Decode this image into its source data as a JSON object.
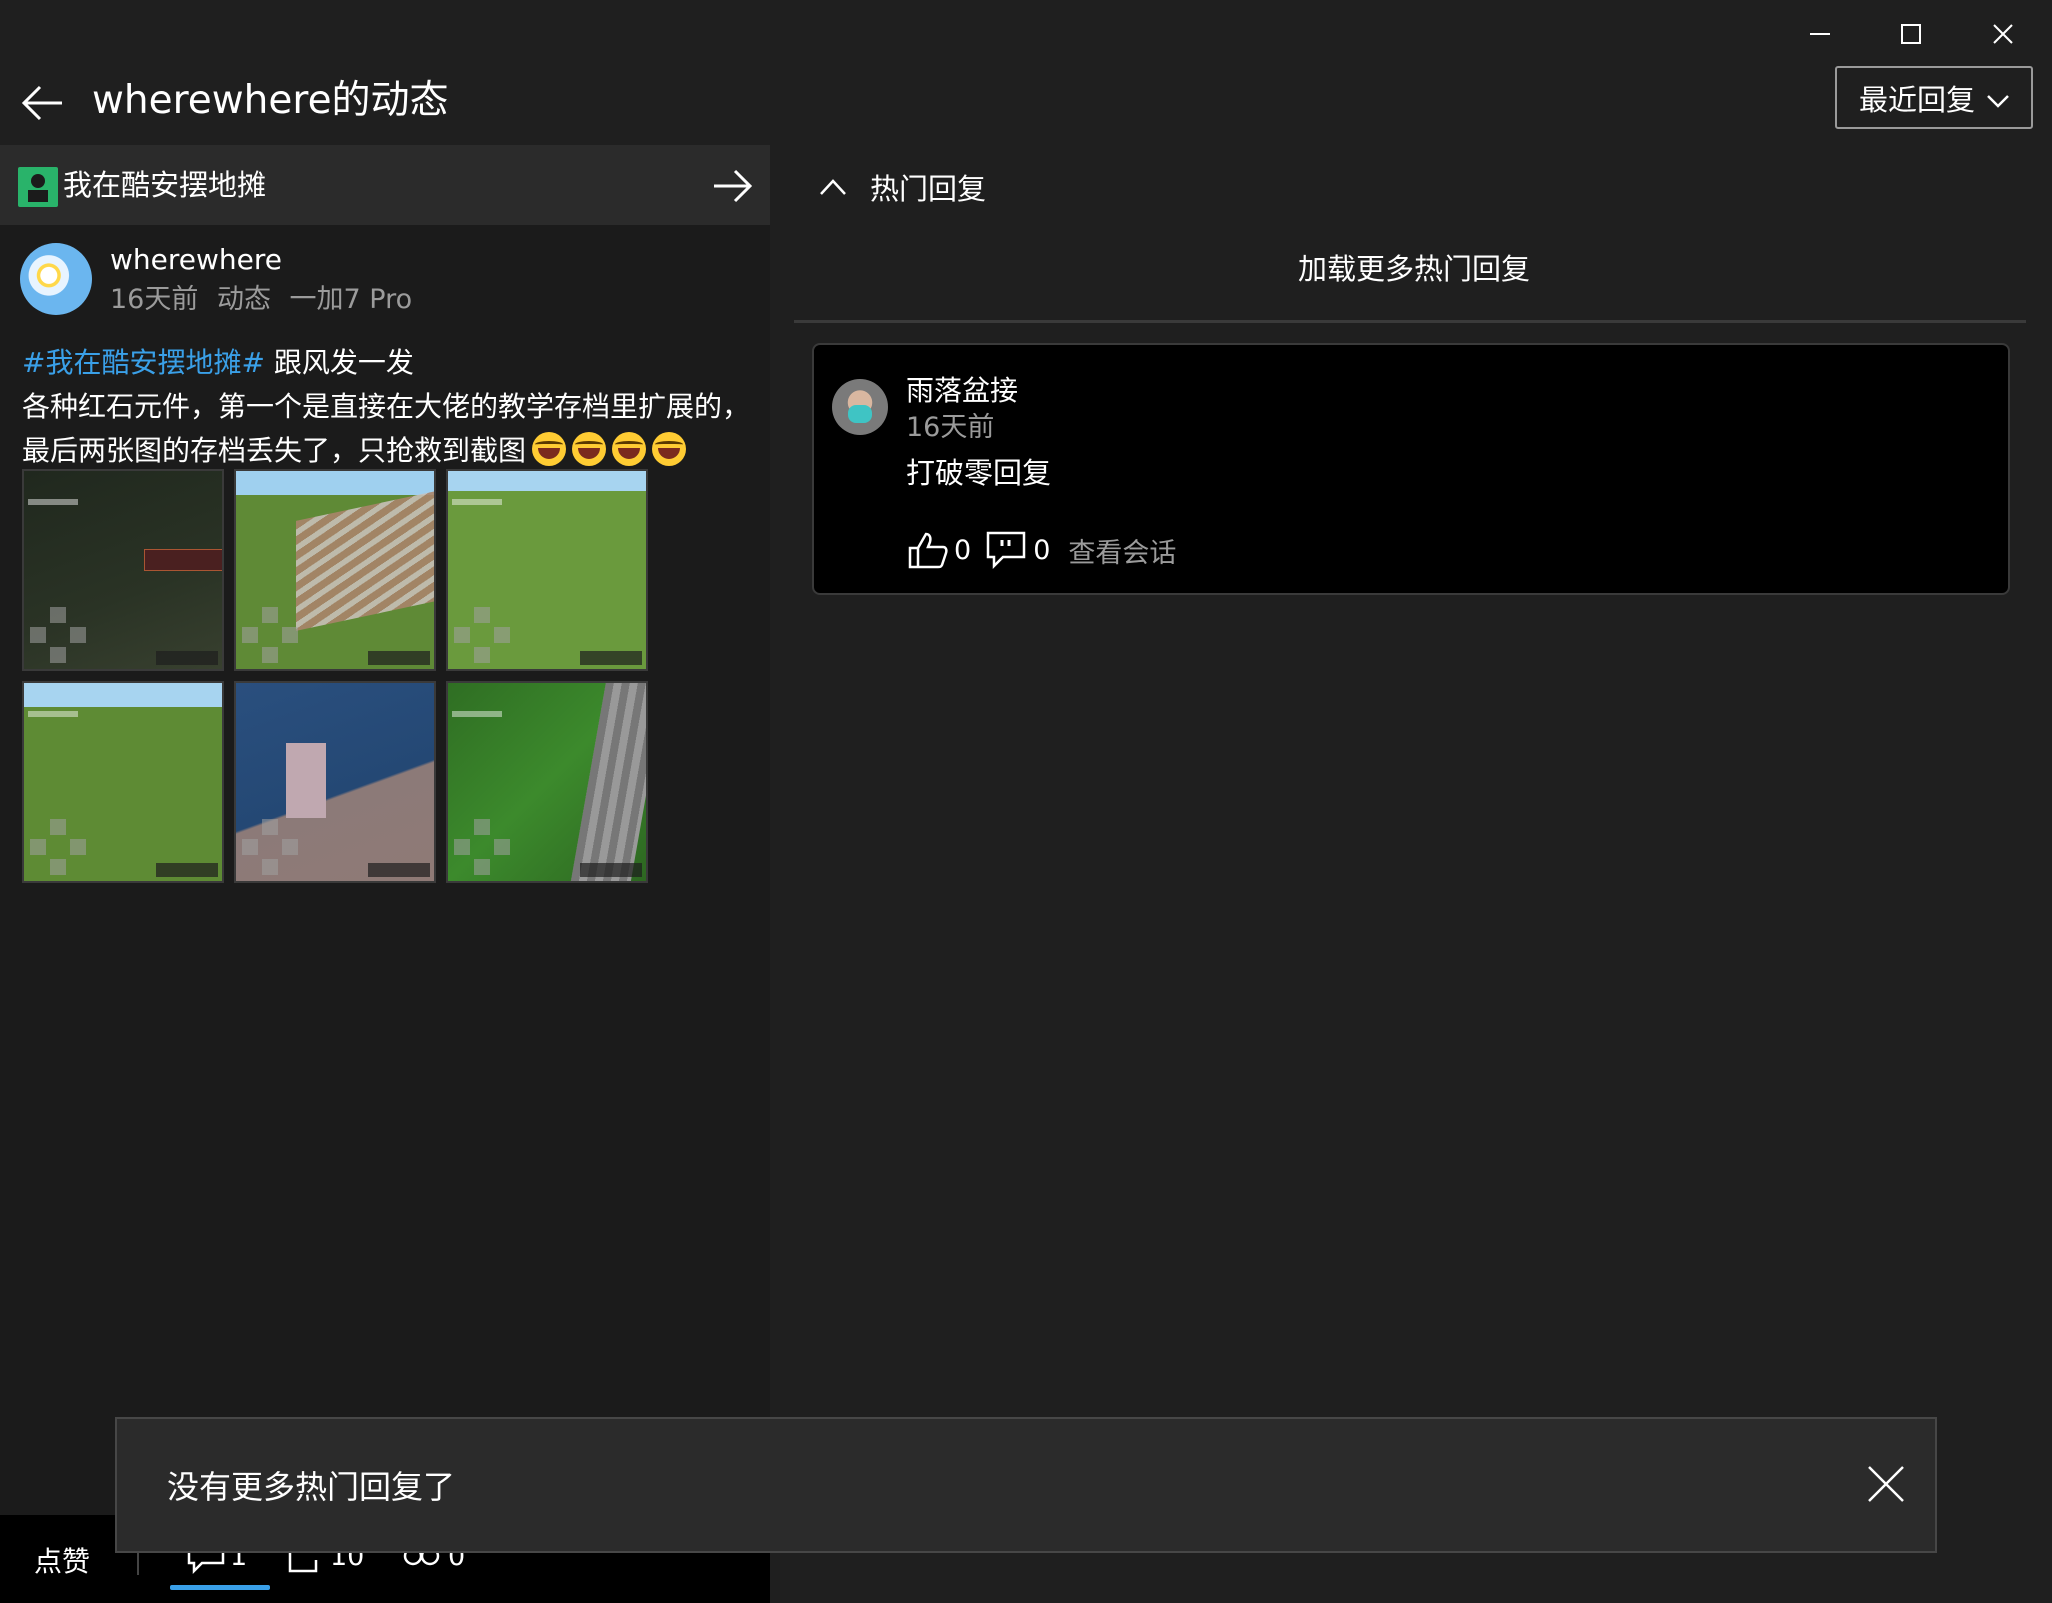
{
  "window": {
    "title": "wherewhere的动态",
    "sort_dropdown": "最近回复"
  },
  "topic": {
    "label": "我在酷安摆地摊"
  },
  "post": {
    "author": "wherewhere",
    "time": "16天前",
    "type": "动态",
    "device": "一加7 Pro",
    "hashtag": "#我在酷安摆地摊#",
    "text_line1": " 跟风发一发",
    "text_line2": "各种红石元件，第一个是直接在大佬的教学存档里扩展的，",
    "text_line3": "最后两张图的存档丢失了，只抢救到截图",
    "emoji_count": 4,
    "image_count": 6
  },
  "actions": {
    "like_label": "点赞",
    "comment_count": "1",
    "forward_count": "10",
    "share_count": "0"
  },
  "hot_replies": {
    "header": "热门回复",
    "load_more": "加载更多热门回复"
  },
  "reply": {
    "user": "雨落盆接",
    "time": "16天前",
    "text": "打破零回复",
    "like_count": "0",
    "reply_count": "0",
    "view_conversation": "查看会话"
  },
  "toast": {
    "message": "没有更多热门回复了"
  },
  "colors": {
    "accent": "#3aa0e8",
    "background": "#1f1f1f",
    "card": "#000000",
    "muted_text": "#9b9b9b"
  }
}
